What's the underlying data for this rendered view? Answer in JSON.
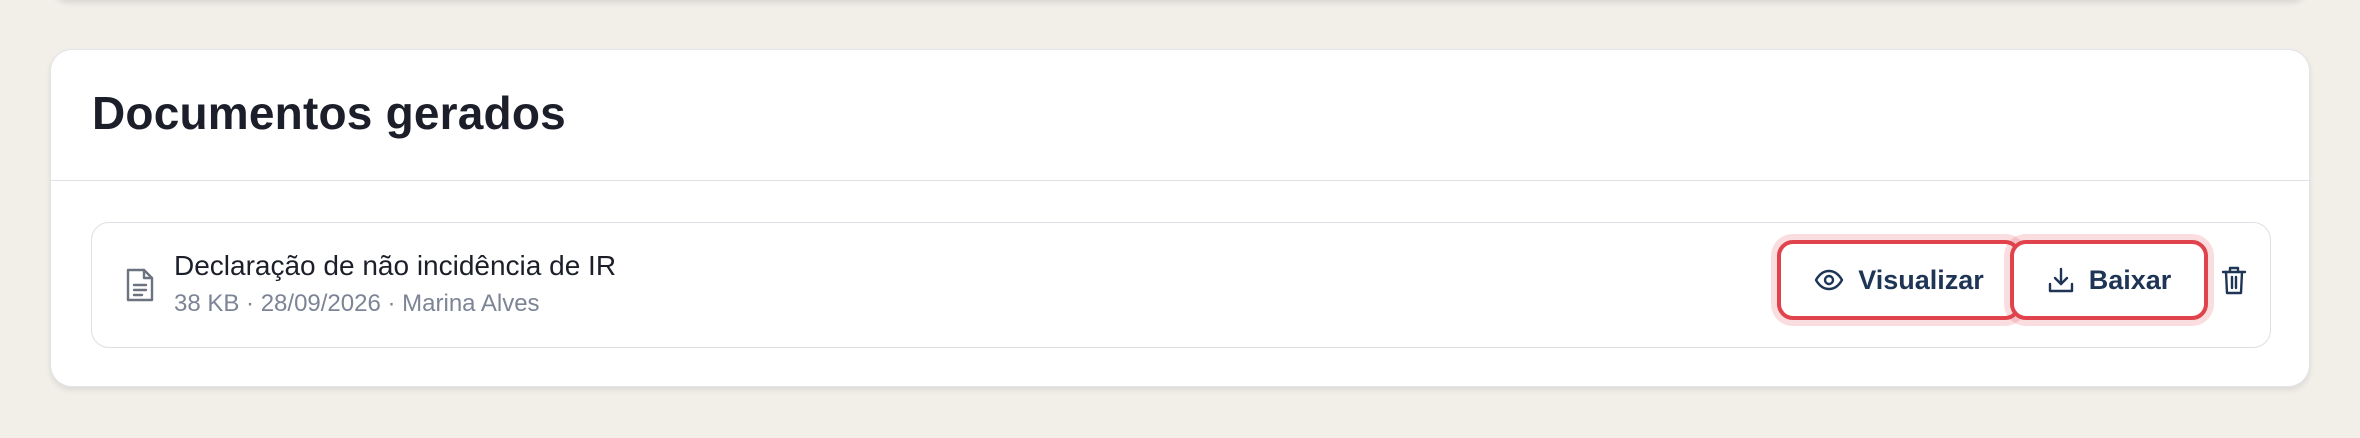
{
  "section": {
    "title": "Documentos gerados"
  },
  "documents": [
    {
      "name": "Declaração de não incidência de IR",
      "meta": "38 KB · 28/09/2026 · Marina Alves",
      "icon": "file-text-icon",
      "actions": {
        "view_label": "Visualizar",
        "view_icon": "eye-icon",
        "download_label": "Baixar",
        "download_icon": "download-icon",
        "delete_icon": "trash-icon"
      }
    }
  ],
  "colors": {
    "page_background": "#f2efe9",
    "card_background": "#ffffff",
    "title_text": "#1c1f29",
    "meta_text": "#7c8496",
    "button_text": "#1e3556",
    "highlight_border": "#e0434b"
  }
}
